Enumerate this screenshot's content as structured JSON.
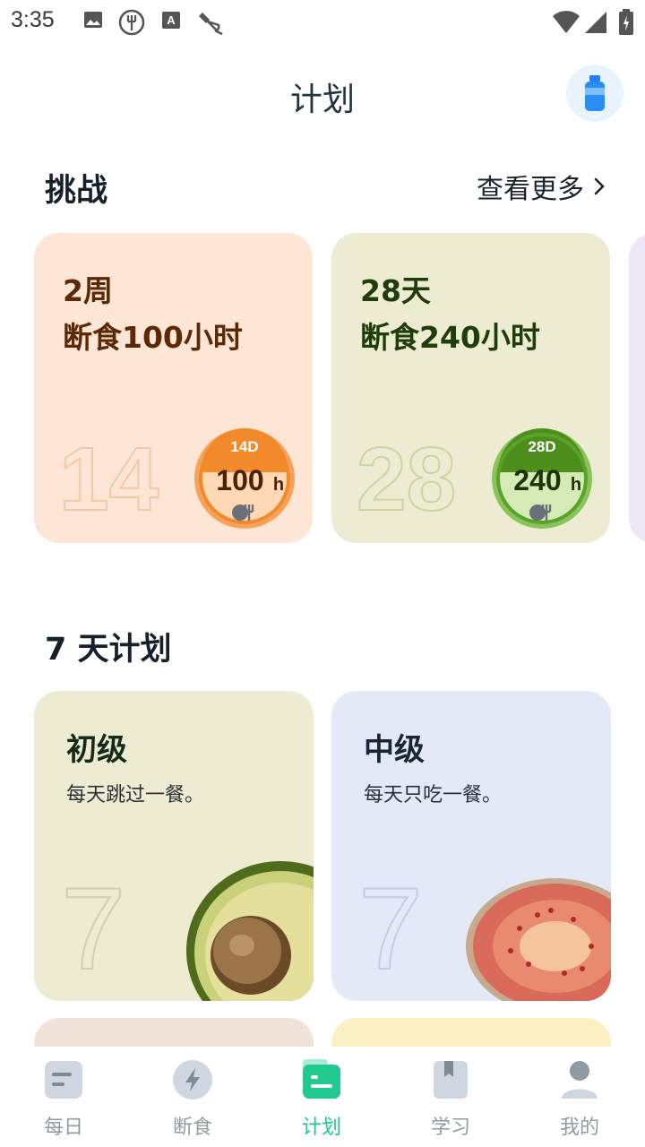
{
  "status_bar": {
    "time": "3:35",
    "left_icons": [
      "image-icon",
      "fork-icon",
      "text-a-icon",
      "satellite-icon"
    ],
    "right_icons": [
      "wifi-icon",
      "cell-signal-icon",
      "battery-icon"
    ]
  },
  "header": {
    "title": "计划",
    "action_icon": "water-bottle-icon"
  },
  "challenge": {
    "title": "挑战",
    "more_label": "查看更多",
    "cards": [
      {
        "line1": "2周",
        "line2": "断食100小时",
        "big_number": "14",
        "badge_top": "14D",
        "badge_value": "100",
        "badge_unit": "h",
        "bg": "#fee6d6",
        "text_color": "#5a2a06",
        "accent": "#f28a2c"
      },
      {
        "line1": "28天",
        "line2": "断食240小时",
        "big_number": "28",
        "badge_top": "28D",
        "badge_value": "240",
        "badge_unit": "h",
        "bg": "#edebd1",
        "text_color": "#1f3d08",
        "accent": "#5aa22a"
      }
    ]
  },
  "plans": {
    "title": "7 天计划",
    "cards": [
      {
        "title": "初级",
        "desc": "每天跳过一餐。",
        "big_number": "7",
        "food": "avocado",
        "bg": "#edebd2"
      },
      {
        "title": "中级",
        "desc": "每天只吃一餐。",
        "big_number": "7",
        "food": "fig",
        "bg": "#e3e9f7"
      }
    ]
  },
  "bottom_nav": {
    "items": [
      {
        "label": "每日",
        "icon": "daily-icon",
        "active": false
      },
      {
        "label": "断食",
        "icon": "lightning-icon",
        "active": false
      },
      {
        "label": "计划",
        "icon": "plan-icon",
        "active": true
      },
      {
        "label": "学习",
        "icon": "bookmark-icon",
        "active": false
      },
      {
        "label": "我的",
        "icon": "profile-icon",
        "active": false
      }
    ]
  }
}
